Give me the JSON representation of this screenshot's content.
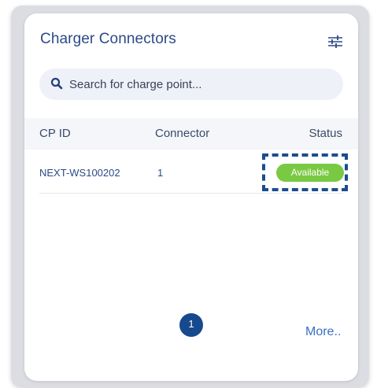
{
  "panel": {
    "title": "Charger Connectors",
    "filter_icon": "sliders-icon"
  },
  "search": {
    "icon": "search-icon",
    "placeholder": "Search for charge point..."
  },
  "table": {
    "columns": [
      "CP ID",
      "Connector",
      "Status"
    ],
    "rows": [
      {
        "cp_id": "NEXT-WS100202",
        "connector": "1",
        "status": "Available"
      }
    ]
  },
  "pagination": {
    "current_page": "1"
  },
  "more_link": "More..",
  "colors": {
    "title": "#2b4a87",
    "status_available": "#7ac943",
    "page_active": "#17498e",
    "highlight_border": "#1a4d8f",
    "link": "#3a6fc4"
  }
}
